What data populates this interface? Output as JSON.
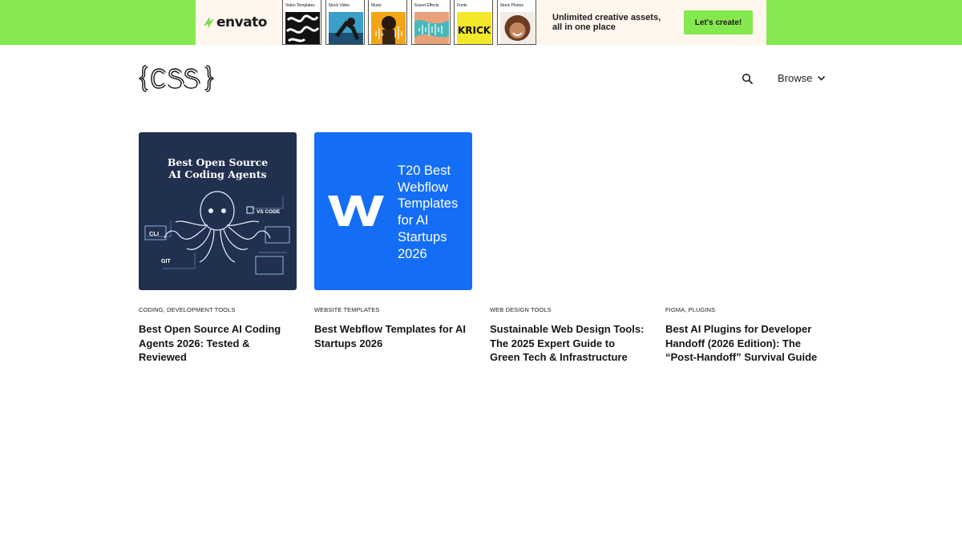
{
  "banner": {
    "brand": "envato",
    "tiles": [
      {
        "label": "Video Templates",
        "icon": "video-templates-thumb"
      },
      {
        "label": "Stock Video",
        "icon": "stock-video-thumb"
      },
      {
        "label": "Music",
        "icon": "music-thumb"
      },
      {
        "label": "Sound Effects",
        "icon": "sound-effects-thumb"
      },
      {
        "label": "Fonts",
        "icon": "fonts-thumb",
        "text": "KRICK"
      },
      {
        "label": "Stock Photos",
        "icon": "stock-photos-thumb"
      }
    ],
    "promo_line1": "Unlimited creative assets,",
    "promo_line2": "all in one place",
    "cta_label": "Let's create!",
    "colors": {
      "accent": "#86e84f",
      "background": "#fff7ee"
    }
  },
  "header": {
    "logo_alt": "{css}",
    "search_icon": "search-icon",
    "browse_label": "Browse"
  },
  "cards": [
    {
      "thumb_title_line1": "Best Open Source",
      "thumb_title_line2": "AI Coding Agents",
      "thumb_labels": {
        "vs_code": "VS CODE",
        "cli": "CLI",
        "git": "GIT"
      },
      "category": "CODING, DEVELOPMENT TOOLS",
      "title": "Best Open Source AI Coding Agents 2026: Tested & Reviewed"
    },
    {
      "thumb_title": "T20 Best Webflow Templates for AI Startups 2026",
      "category": "WEBSITE TEMPLATES",
      "title": "Best Webflow Templates for AI Startups 2026"
    },
    {
      "category": "WEB DESIGN TOOLS",
      "title": "Sustainable Web Design Tools: The 2025 Expert Guide to Green Tech & Infrastructure"
    },
    {
      "category": "FIGMA, PLUGINS",
      "title": "Best AI Plugins for Developer Handoff (2026 Edition): The “Post-Handoff” Survival Guide"
    }
  ]
}
